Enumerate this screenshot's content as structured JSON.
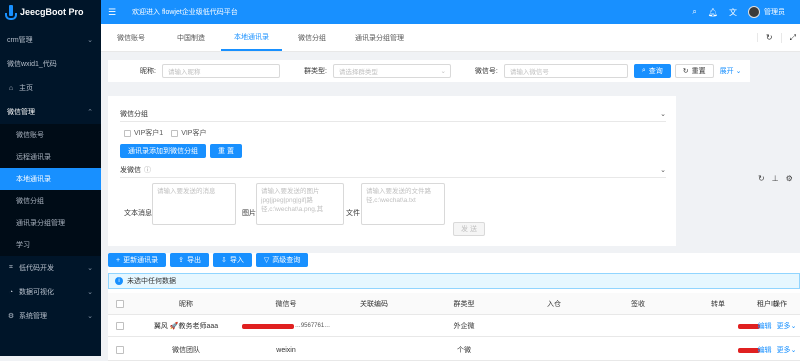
{
  "app": {
    "title": "JeecgBoot Pro"
  },
  "topbar": {
    "welcome": "欢迎进入 flowjet企业级低代码平台",
    "user_name": "管理员"
  },
  "sidebar": {
    "items": [
      {
        "label": "crm管理",
        "icon": "crm-icon"
      },
      {
        "label": "微信wxid1_代码",
        "icon": "wechat-icon"
      },
      {
        "label": "主页",
        "icon": "home-icon"
      },
      {
        "label": "微信管理",
        "icon": "wechat-icon"
      }
    ],
    "sub_items": [
      "微信账号",
      "远程通讯录",
      "本地通讯录",
      "微信分组",
      "通讯录分组管理",
      "学习"
    ],
    "bottom_items": [
      {
        "label": "低代码开发",
        "icon": "code-icon"
      },
      {
        "label": "数据可视化",
        "icon": "chart-icon"
      },
      {
        "label": "系统管理",
        "icon": "settings-icon"
      }
    ]
  },
  "tabs": [
    "微信账号",
    "中国制造",
    "本地通讯录",
    "微信分组",
    "通讯录分组管理"
  ],
  "search": {
    "nickname_label": "昵称:",
    "nickname_placeholder": "请输入昵称",
    "group_type_label": "群类型:",
    "group_type_placeholder": "请选择群类型",
    "wechat_label": "微信号:",
    "wechat_placeholder": "请输入微信号",
    "query_btn": "查询",
    "reset_btn": "重置",
    "expand_link": "展开"
  },
  "panel": {
    "group_title": "微信分组",
    "checkboxes": [
      "VIP客户1",
      "VIP客户"
    ],
    "add_to_group_btn": "通讯录添加到微信分组",
    "reset_btn": "重 置",
    "send_title": "发微信",
    "text_msg_label": "文本消息",
    "text_msg_placeholder": "请输入要发送的消息",
    "image_label": "图片",
    "image_placeholder": "请输入要发送的图片jpg|jpeg|png|gif|路径,c:\\wechat\\a.png,其",
    "file_label": "文件",
    "file_placeholder": "请输入要发送的文件路径,c:\\wechat\\a.txt",
    "send_btn": "发 送"
  },
  "toolbar": {
    "add": "更新通讯录",
    "export": "导出",
    "import": "导入",
    "advanced": "高级查询"
  },
  "alert": {
    "text": "未选中任何数据"
  },
  "table": {
    "columns": [
      "昵称",
      "微信号",
      "关联编码",
      "群类型",
      "入仓",
      "签收",
      "转单",
      "租户ID",
      "操作"
    ],
    "rows": [
      {
        "nickname": "翼风 🚀教务老师aaa",
        "wechat": "…9567761…",
        "code": "",
        "group_type": "外企微",
        "tenant": "",
        "edit": "编辑",
        "more": "更多"
      },
      {
        "nickname": "微信团队",
        "wechat": "weixin",
        "code": "",
        "group_type": "个微",
        "tenant": "",
        "edit": "编辑",
        "more": "更多"
      }
    ]
  }
}
